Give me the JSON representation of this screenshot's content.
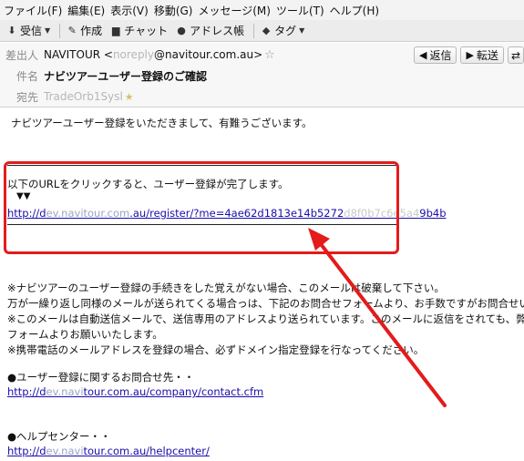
{
  "menu": [
    "ファイル(F)",
    "編集(E)",
    "表示(V)",
    "移動(G)",
    "メッセージ(M)",
    "ツール(T)",
    "ヘルプ(H)"
  ],
  "toolbar": {
    "receive": "受信",
    "compose": "作成",
    "chat": "チャット",
    "address_book": "アドレス帳",
    "tag": "タグ"
  },
  "header": {
    "from_label": "差出人",
    "from_value": "NAVITOUR <",
    "from_email_hidden": "noreply",
    "from_email_rest": "@navitour.com.au>",
    "subject_label": "件名",
    "subject_value": "ナビツアーユーザー登録のご確認",
    "to_label": "宛先",
    "to_value_hidden": "TradeOrb1Sysl",
    "reply_button": "返信",
    "forward_button": "転送"
  },
  "body": {
    "greeting": "ナビツアーユーザー登録をいただきまして、有難うございます。",
    "instruction": "以下のURLをクリックすると、ユーザー登録が完了します。",
    "arrows": "▼▼",
    "url_start": "http://d",
    "url_hidden1": "ev.navitour.com",
    "url_mid": ".au/register/?me=4ae62d1813e14b5272",
    "url_hidden2": "d8f0b7c6e5a4",
    "url_end": "9b4b",
    "note1": "※ナビツアーのユーザー登録の手続きをした覚えがない場合、このメールは破棄して下さい。",
    "note2": "万が一繰り返し同様のメールが送られてくる場合っは、下記のお問合せフォームより、お手数ですがお問合せいただ",
    "note3": "※このメールは自動送信メールで、送信専用のアドレスより送られています。このメールに返信をされても、弊社に",
    "note4": "フォームよりお願いいたします。",
    "note5": "※携帯電話のメールアドレスを登録の場合、必ずドメイン指定登録を行なってください。",
    "contact_heading": "●ユーザー登録に関するお問合せ先・・",
    "contact_url_start": "http://d",
    "contact_url_hidden": "ev.navi",
    "contact_url_end": "tour.com.au/company/contact.cfm",
    "help_heading": "●ヘルプセンター・・",
    "help_url_start": "http://d",
    "help_url_hidden": "ev.navi",
    "help_url_end": "tour.com.au/helpcenter/"
  },
  "colors": {
    "annotation": "#e31b1b",
    "link": "#1a0dab"
  },
  "icons": [
    "download-icon",
    "pencil-icon",
    "chat-icon",
    "contact-icon",
    "tag-icon",
    "star-icon",
    "reply-icon",
    "forward-icon"
  ]
}
